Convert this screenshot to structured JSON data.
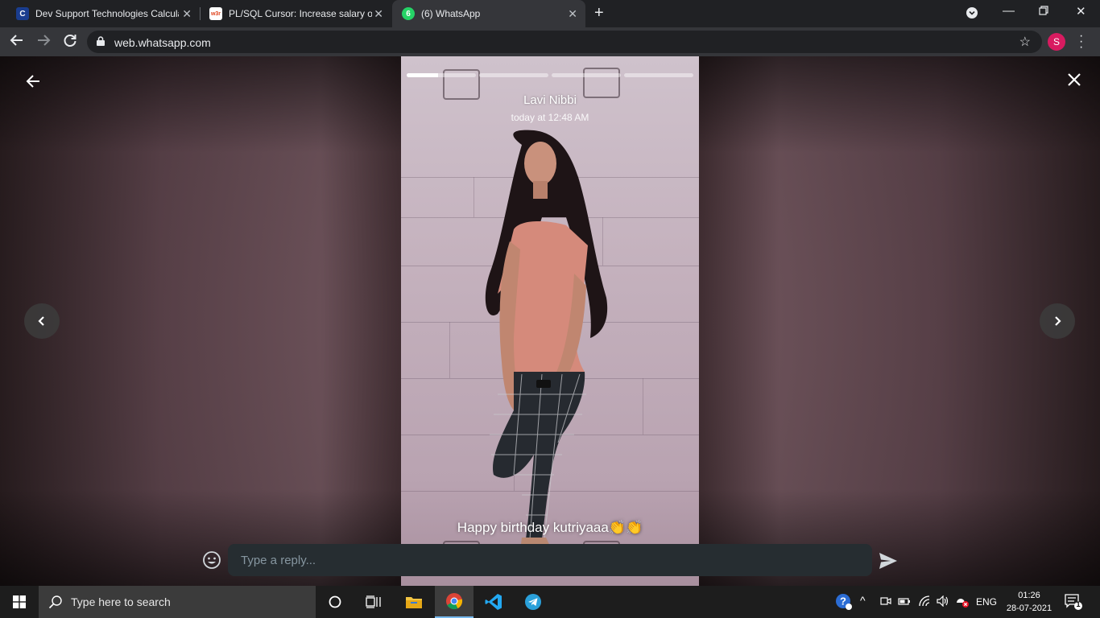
{
  "browser": {
    "tabs": [
      {
        "favicon": "C",
        "title": "Dev Support Technologies Calculator",
        "active": false
      },
      {
        "favicon": "w3r",
        "title": "PL/SQL Cursor: Increase salary of employees",
        "active": false
      },
      {
        "favicon": "6",
        "title": "(6) WhatsApp",
        "active": true
      }
    ],
    "url": "web.whatsapp.com",
    "profile_initial": "S"
  },
  "status": {
    "poster_name": "Lavi Nibbi",
    "posted_time": "today at 12:48 AM",
    "caption": "Happy birthday kutriyaaa👏👏",
    "progress": [
      0.45,
      0,
      0,
      0
    ],
    "reply_placeholder": "Type a reply..."
  },
  "taskbar": {
    "search_placeholder": "Type here to search",
    "language": "ENG",
    "time": "01:26",
    "date": "28-07-2021",
    "notification_count": "1"
  },
  "colors": {
    "whatsapp_green": "#25d366",
    "profile_pink": "#d81b60",
    "reply_bg": "#262d31"
  }
}
